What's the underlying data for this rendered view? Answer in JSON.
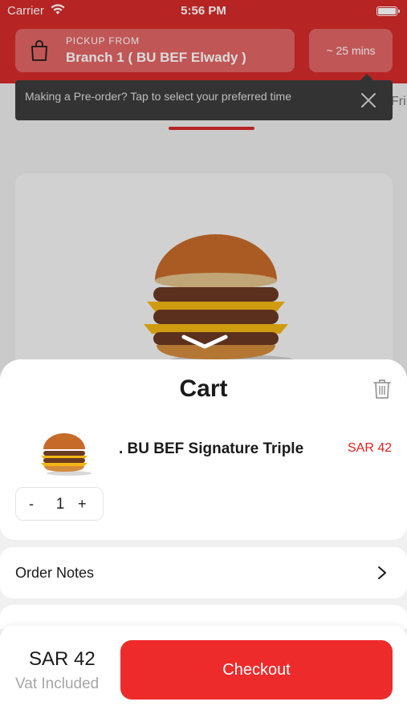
{
  "status_bar": {
    "carrier": "Carrier",
    "time": "5:56 PM",
    "wifi_icon": "wifi-icon",
    "battery_icon": "battery-icon"
  },
  "header": {
    "pickup_label": "PICKUP FROM",
    "branch_name": "Branch 1 ( BU BEF Elwady )",
    "eta": "~ 25 mins",
    "bag_icon": "shopping-bag-icon"
  },
  "tabs": {
    "peek_label": "Fri"
  },
  "tooltip": {
    "text": "Making a Pre-order? Tap to select your preferred time",
    "close_icon": "close-icon"
  },
  "cart": {
    "title": "Cart",
    "trash_icon": "trash-icon",
    "items": [
      {
        "name": ". BU BEF Signature Triple",
        "price": "SAR 42",
        "quantity": "1",
        "minus": "-",
        "plus": "+"
      }
    ]
  },
  "order_notes": {
    "label": "Order Notes",
    "chevron_icon": "chevron-right-icon"
  },
  "footer": {
    "total": "SAR 42",
    "vat_note": "Vat Included",
    "checkout_label": "Checkout"
  },
  "colors": {
    "brand_red": "#d42a2a",
    "checkout_red": "#ee2b2b",
    "price_red": "#e02020"
  }
}
